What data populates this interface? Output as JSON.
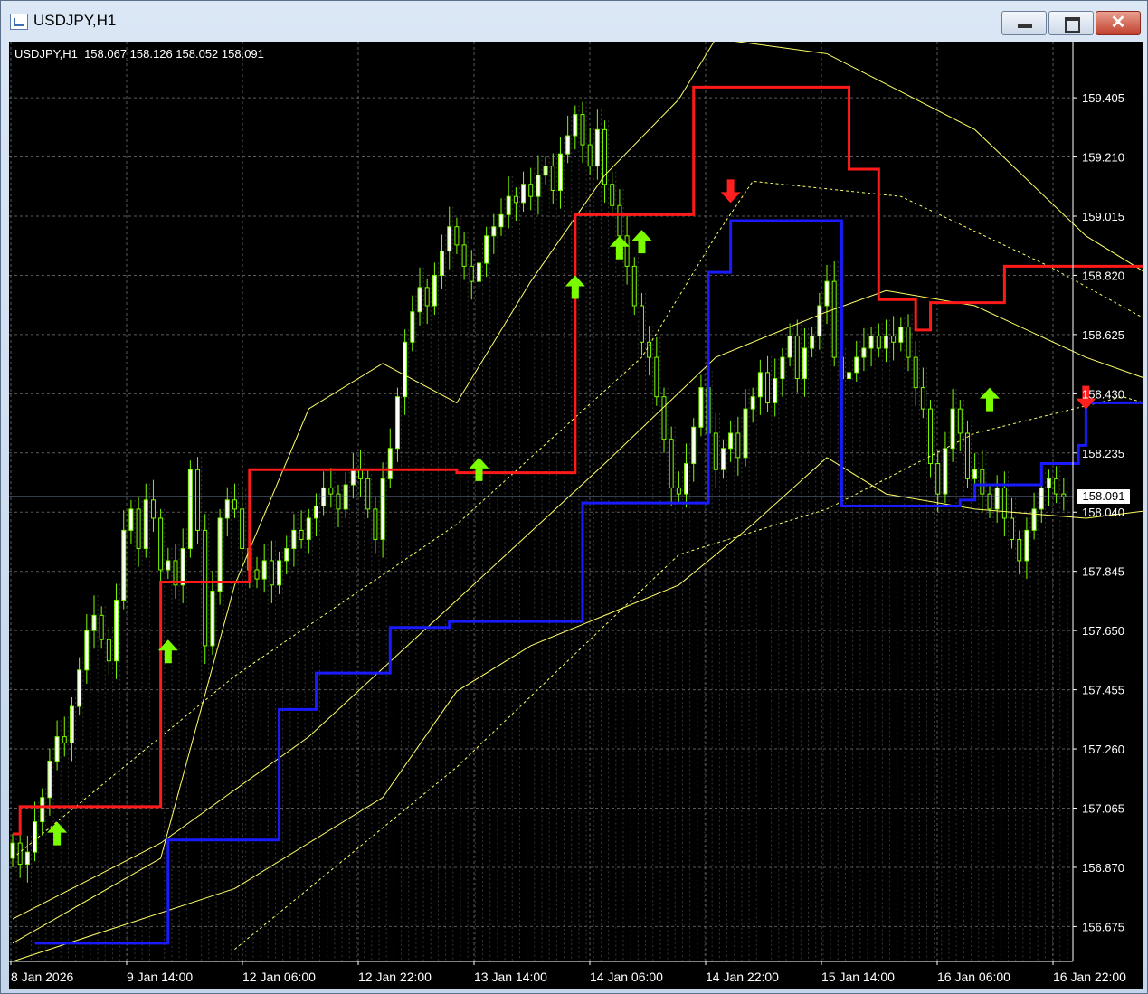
{
  "window": {
    "title": "USDJPY,H1",
    "close_label": "✕"
  },
  "chart_header": {
    "symbol": "USDJPY,H1",
    "ohlc": "158.067 158.126 158.052 158.091"
  },
  "current_price": "158.091",
  "colors": {
    "background": "#000000",
    "grid": "#5a5a5a",
    "bull": "#7cfc00",
    "bear": "#ffffff",
    "red_stop": "#ff1a1a",
    "blue_stop": "#1a1aff",
    "bands": "#ffff66",
    "up_arrow": "#7cfc00",
    "down_arrow": "#ff2020"
  },
  "chart_data": {
    "type": "candlestick",
    "y_ticks": [
      159.405,
      159.21,
      159.015,
      158.82,
      158.625,
      158.43,
      158.235,
      158.04,
      157.845,
      157.65,
      157.455,
      157.26,
      157.065,
      156.87,
      156.675
    ],
    "y_tick_labels": [
      "159.405",
      "159.210",
      "159.015",
      "158.820",
      "158.625",
      "158.430",
      "158.235",
      "158.040",
      "157.845",
      "157.650",
      "157.455",
      "157.260",
      "157.065",
      "156.870",
      "156.675"
    ],
    "x_tick_labels": [
      "8 Jan 2026",
      "9 Jan 14:00",
      "12 Jan 06:00",
      "12 Jan 22:00",
      "13 Jan 14:00",
      "14 Jan 06:00",
      "14 Jan 22:00",
      "15 Jan 14:00",
      "16 Jan 06:00",
      "16 Jan 22:00"
    ],
    "ylim": [
      156.56,
      159.59
    ],
    "closes": [
      156.95,
      156.88,
      156.92,
      157.02,
      157.1,
      157.22,
      157.3,
      157.28,
      157.4,
      157.52,
      157.65,
      157.7,
      157.62,
      157.55,
      157.75,
      157.98,
      158.05,
      157.92,
      158.08,
      158.02,
      157.85,
      157.88,
      157.8,
      157.92,
      158.18,
      157.98,
      157.6,
      157.78,
      158.02,
      158.08,
      158.05,
      157.92,
      157.85,
      157.82,
      157.88,
      157.8,
      157.88,
      157.92,
      157.98,
      157.95,
      158.02,
      158.06,
      158.12,
      158.1,
      158.05,
      158.13,
      158.18,
      158.15,
      158.05,
      157.95,
      158.15,
      158.25,
      158.42,
      158.6,
      158.7,
      158.78,
      158.72,
      158.82,
      158.9,
      158.98,
      158.92,
      158.85,
      158.8,
      158.86,
      158.95,
      158.98,
      159.02,
      159.08,
      159.06,
      159.12,
      159.08,
      159.15,
      159.18,
      159.1,
      159.22,
      159.28,
      159.35,
      159.25,
      159.18,
      159.3,
      159.12,
      159.05,
      158.95,
      158.85,
      158.72,
      158.6,
      158.55,
      158.42,
      158.28,
      158.12,
      158.1,
      158.2,
      158.32,
      158.45,
      158.3,
      158.18,
      158.25,
      158.3,
      158.22,
      158.38,
      158.42,
      158.5,
      158.4,
      158.48,
      158.55,
      158.62,
      158.48,
      158.58,
      158.62,
      158.72,
      158.8,
      158.55,
      158.48,
      158.5,
      158.55,
      158.58,
      158.62,
      158.58,
      158.62,
      158.6,
      158.65,
      158.55,
      158.45,
      158.38,
      158.2,
      158.1,
      158.25,
      158.38,
      158.3,
      158.15,
      158.18,
      158.1,
      158.05,
      158.12,
      158.02,
      157.95,
      157.88,
      157.98,
      158.05,
      158.12,
      158.15,
      158.1,
      158.09
    ],
    "up_arrows": [
      {
        "bar": 6,
        "price": 157.02
      },
      {
        "bar": 21,
        "price": 157.62
      },
      {
        "bar": 63,
        "price": 158.22
      },
      {
        "bar": 76,
        "price": 158.82
      },
      {
        "bar": 82,
        "price": 158.95
      },
      {
        "bar": 85,
        "price": 158.97
      },
      {
        "bar": 132,
        "price": 158.45
      }
    ],
    "down_arrows": [
      {
        "bar": 97,
        "price": 159.13
      },
      {
        "bar": 145,
        "price": 158.45
      }
    ],
    "red_stop": [
      [
        0,
        156.98
      ],
      [
        1,
        157.07
      ],
      [
        19,
        157.07
      ],
      [
        20,
        157.81
      ],
      [
        31,
        157.81
      ],
      [
        32,
        158.18
      ],
      [
        58,
        158.18
      ],
      [
        60,
        158.17
      ],
      [
        75,
        158.17
      ],
      [
        76,
        159.02
      ],
      [
        91,
        159.02
      ],
      [
        92,
        159.44
      ],
      [
        112,
        159.44
      ],
      [
        113,
        159.17
      ],
      [
        115,
        159.17
      ],
      [
        117,
        158.74
      ],
      [
        121,
        158.74
      ],
      [
        122,
        158.64
      ],
      [
        123,
        158.64
      ],
      [
        124,
        158.73
      ],
      [
        132,
        158.73
      ],
      [
        134,
        158.85
      ],
      [
        164,
        158.85
      ],
      [
        166,
        158.42
      ],
      [
        168,
        158.42
      ]
    ],
    "blue_stop": [
      [
        3,
        156.62
      ],
      [
        20,
        156.62
      ],
      [
        21,
        156.96
      ],
      [
        34,
        156.96
      ],
      [
        36,
        157.39
      ],
      [
        39,
        157.39
      ],
      [
        41,
        157.51
      ],
      [
        49,
        157.51
      ],
      [
        51,
        157.66
      ],
      [
        57,
        157.66
      ],
      [
        59,
        157.68
      ],
      [
        75,
        157.68
      ],
      [
        77,
        158.07
      ],
      [
        92,
        158.07
      ],
      [
        94,
        158.83
      ],
      [
        96,
        158.83
      ],
      [
        97,
        159.0
      ],
      [
        110,
        159.0
      ],
      [
        112,
        158.06
      ],
      [
        126,
        158.06
      ],
      [
        128,
        158.08
      ],
      [
        128,
        158.08
      ],
      [
        130,
        158.13
      ],
      [
        137,
        158.13
      ],
      [
        139,
        158.2
      ],
      [
        142,
        158.2
      ],
      [
        144,
        158.26
      ],
      [
        145,
        158.4
      ],
      [
        160,
        158.4
      ],
      [
        162,
        157.82
      ],
      [
        168,
        157.82
      ]
    ],
    "band_upper": [
      [
        0,
        156.62
      ],
      [
        20,
        156.9
      ],
      [
        30,
        157.8
      ],
      [
        40,
        158.38
      ],
      [
        50,
        158.53
      ],
      [
        60,
        158.4
      ],
      [
        70,
        158.8
      ],
      [
        80,
        159.15
      ],
      [
        90,
        159.4
      ],
      [
        95,
        159.6
      ],
      [
        110,
        159.55
      ],
      [
        130,
        159.3
      ],
      [
        145,
        158.95
      ],
      [
        155,
        158.8
      ],
      [
        168,
        158.8
      ]
    ],
    "band_middle": [
      [
        0,
        156.7
      ],
      [
        20,
        156.95
      ],
      [
        40,
        157.3
      ],
      [
        60,
        157.75
      ],
      [
        80,
        158.2
      ],
      [
        95,
        158.55
      ],
      [
        110,
        158.7
      ],
      [
        118,
        158.77
      ],
      [
        130,
        158.72
      ],
      [
        145,
        158.55
      ],
      [
        160,
        158.42
      ],
      [
        168,
        158.4
      ]
    ],
    "band_lower": [
      [
        0,
        156.56
      ],
      [
        30,
        156.8
      ],
      [
        50,
        157.1
      ],
      [
        60,
        157.45
      ],
      [
        70,
        157.6
      ],
      [
        80,
        157.7
      ],
      [
        90,
        157.8
      ],
      [
        100,
        158.0
      ],
      [
        110,
        158.22
      ],
      [
        118,
        158.1
      ],
      [
        130,
        158.05
      ],
      [
        145,
        158.02
      ],
      [
        155,
        158.05
      ],
      [
        168,
        157.88
      ]
    ],
    "ma_dotted": [
      [
        0,
        156.9
      ],
      [
        30,
        157.5
      ],
      [
        60,
        158.0
      ],
      [
        85,
        158.55
      ],
      [
        95,
        158.95
      ],
      [
        100,
        159.13
      ],
      [
        120,
        159.08
      ],
      [
        140,
        158.85
      ],
      [
        155,
        158.65
      ],
      [
        168,
        158.6
      ]
    ],
    "ma_dotted2": [
      [
        30,
        156.6
      ],
      [
        60,
        157.2
      ],
      [
        90,
        157.9
      ],
      [
        110,
        158.05
      ],
      [
        130,
        158.3
      ],
      [
        150,
        158.42
      ],
      [
        160,
        158.35
      ],
      [
        168,
        158.2
      ]
    ]
  }
}
